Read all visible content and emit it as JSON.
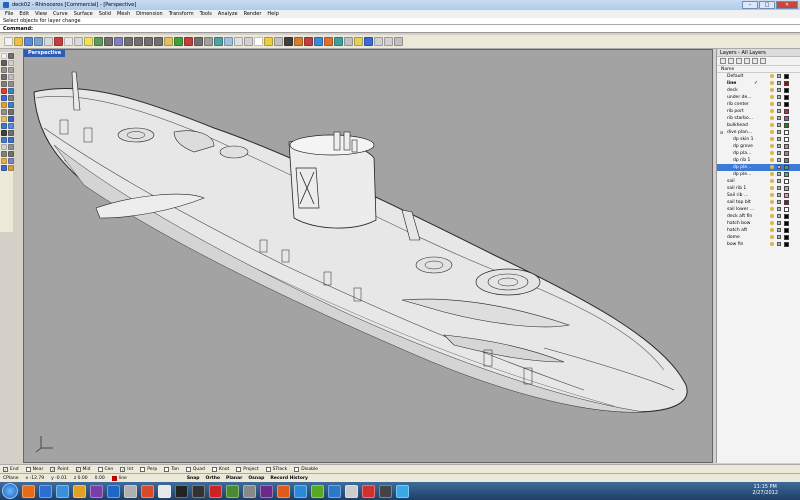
{
  "window": {
    "title": "deck02 - Rhinoceros [Commercial] - [Perspective]",
    "minimize": "–",
    "maximize": "□",
    "close": "✕"
  },
  "menu": [
    "File",
    "Edit",
    "View",
    "Curve",
    "Surface",
    "Solid",
    "Mesh",
    "Dimension",
    "Transform",
    "Tools",
    "Analyze",
    "Render",
    "Help"
  ],
  "command_history": "Select objects for layer change",
  "command_prompt": "Command:",
  "viewport": {
    "tab": "Perspective",
    "background": "#a3a3a3"
  },
  "layers_panel": {
    "title": "Layers - All Layers",
    "column_name": "Name",
    "layers": [
      {
        "name": "Default",
        "color": "#000000"
      },
      {
        "name": "line",
        "color": "#c00000",
        "current": true,
        "check": "✓"
      },
      {
        "name": "deck",
        "color": "#000000"
      },
      {
        "name": "under de...",
        "color": "#000000"
      },
      {
        "name": "rib center",
        "color": "#000000"
      },
      {
        "name": "rib port",
        "color": "#c03030"
      },
      {
        "name": "rib starbo...",
        "color": "#c040c0"
      },
      {
        "name": "bulkhead",
        "color": "#208020"
      },
      {
        "name": "dive plan...",
        "color": "#ffffff",
        "group": true
      },
      {
        "name": "dp skin 1",
        "color": "#ffffff",
        "indent": true
      },
      {
        "name": "dp grove",
        "color": "#d080a0",
        "indent": true
      },
      {
        "name": "dp pla...",
        "color": "#b08080",
        "indent": true
      },
      {
        "name": "dp rib 1",
        "color": "#808080",
        "indent": true
      },
      {
        "name": "dp ple...",
        "color": "#3aa0a0",
        "indent": true,
        "selected": true
      },
      {
        "name": "dp ple...",
        "color": "#20c0a0",
        "indent": true
      },
      {
        "name": "sail",
        "color": "#ffffff"
      },
      {
        "name": "sail rib 1",
        "color": "#e090b0"
      },
      {
        "name": "Sail rib ...",
        "color": "#e090b0"
      },
      {
        "name": "sail top blt",
        "color": "#c00000"
      },
      {
        "name": "sail lower ...",
        "color": "#ffffff"
      },
      {
        "name": "deck aft fin",
        "color": "#000000"
      },
      {
        "name": "hatch bow",
        "color": "#000000"
      },
      {
        "name": "hatch aft",
        "color": "#000000"
      },
      {
        "name": "dome",
        "color": "#000000"
      },
      {
        "name": "bow fin",
        "color": "#000000"
      }
    ]
  },
  "osnap": [
    {
      "label": "End",
      "checked": true
    },
    {
      "label": "Near",
      "checked": false
    },
    {
      "label": "Point",
      "checked": true
    },
    {
      "label": "Mid",
      "checked": true
    },
    {
      "label": "Cen",
      "checked": false
    },
    {
      "label": "Int",
      "checked": true
    },
    {
      "label": "Perp",
      "checked": false
    },
    {
      "label": "Tan",
      "checked": false
    },
    {
      "label": "Quad",
      "checked": false
    },
    {
      "label": "Knot",
      "checked": false
    },
    {
      "label": "Project",
      "checked": false
    },
    {
      "label": "STrack",
      "checked": false
    },
    {
      "label": "Disable",
      "checked": false
    }
  ],
  "status": {
    "cplane": "CPlane",
    "x": "x -12.79",
    "y": "y -0.01",
    "z": "z 0.00",
    "dist": "0.00",
    "layer": "line",
    "layer_color": "#c00000",
    "modes": [
      "Snap",
      "Ortho",
      "Planar",
      "Osnap",
      "Record History"
    ]
  },
  "taskbar": {
    "time": "11:15 PM",
    "date": "2/27/2012",
    "icons": [
      "#e66a1a",
      "#2b6fd1",
      "#3c8fd8",
      "#e0a020",
      "#7a3ea6",
      "#1f66c9",
      "#b0b0b0",
      "#d84a2b",
      "#e8e8e8",
      "#222222",
      "#333333",
      "#cc2222",
      "#4a8a30",
      "#888888",
      "#6a2a8a",
      "#e05a1a",
      "#2a8ad8",
      "#55aa22",
      "#2a7ac8",
      "#cccccc",
      "#d03030",
      "#444444",
      "#38a8e8"
    ]
  },
  "toolbar_icons": [
    "#f2f2f2",
    "#e8c24a",
    "#5a8ad8",
    "#7aa0d0",
    "#d8d8d8",
    "#c04040",
    "#e8e8e8",
    "#d8d8d8",
    "#f0e060",
    "#5a9a5a",
    "#707070",
    "#8080c0",
    "#707070",
    "#707070",
    "#707070",
    "#707070",
    "#e0c060",
    "#40a040",
    "#c04040",
    "#707070",
    "#a0a0a0",
    "#50a0a0",
    "#a0c0e0",
    "#e0e0e0",
    "#d0d0d0",
    "#ffffff",
    "#e8d040",
    "#c0c0c0",
    "#404040",
    "#d08030",
    "#c04040",
    "#3a8ad8",
    "#e07030",
    "#40a0a0",
    "#c0c0c0",
    "#e0d060",
    "#3a6ad8",
    "#d0d0d0",
    "#d0d0d0",
    "#c0c0c0"
  ],
  "left_tools": [
    "#f2f2f2",
    "#707070",
    "#606060",
    "#d0d0d0",
    "#909090",
    "#a0a0a0",
    "#707070",
    "#c0c0c0",
    "#808080",
    "#909090",
    "#d04040",
    "#4080c0",
    "#3a6ad8",
    "#808080",
    "#e0a040",
    "#4080c0",
    "#909090",
    "#707070",
    "#e0c060",
    "#4060c0",
    "#3a7ac8",
    "#5a8ad8",
    "#404040",
    "#707070",
    "#4a7ad0",
    "#3a70c8",
    "#d0d0d0",
    "#909090",
    "#808080",
    "#707070",
    "#e0b040",
    "#8080c0",
    "#3a6ad8",
    "#d0a040"
  ]
}
